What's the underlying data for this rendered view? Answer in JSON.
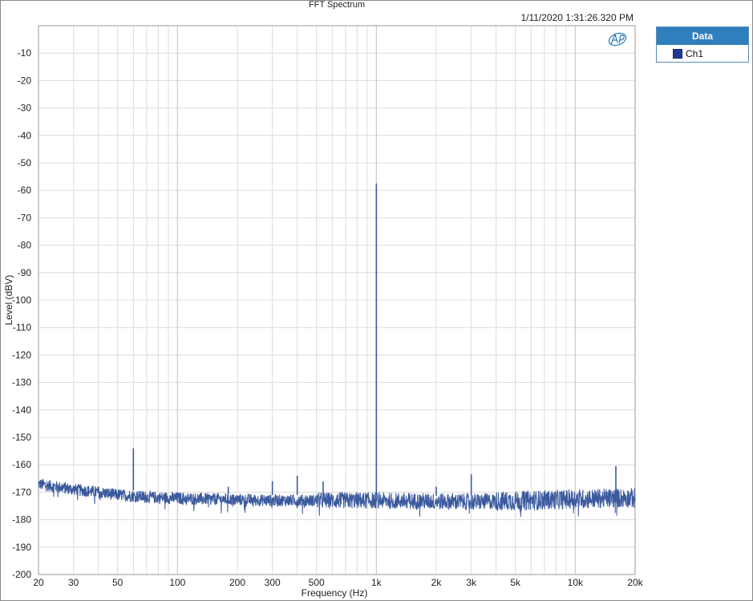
{
  "chart_data": {
    "type": "line",
    "title": "FFT Spectrum",
    "timestamp": "1/11/2020 1:31:26.320 PM",
    "xlabel": "Frequency (Hz)",
    "ylabel": "Level (dBV)",
    "xscale": "log",
    "xlim": [
      20,
      20000
    ],
    "ylim": [
      -200,
      0
    ],
    "grid": true,
    "x_ticks": [
      {
        "value": 20,
        "label": "20"
      },
      {
        "value": 30,
        "label": "30"
      },
      {
        "value": 50,
        "label": "50"
      },
      {
        "value": 100,
        "label": "100"
      },
      {
        "value": 200,
        "label": "200"
      },
      {
        "value": 300,
        "label": "300"
      },
      {
        "value": 500,
        "label": "500"
      },
      {
        "value": 1000,
        "label": "1k"
      },
      {
        "value": 2000,
        "label": "2k"
      },
      {
        "value": 3000,
        "label": "3k"
      },
      {
        "value": 5000,
        "label": "5k"
      },
      {
        "value": 10000,
        "label": "10k"
      },
      {
        "value": 20000,
        "label": "20k"
      }
    ],
    "y_ticks": [
      {
        "value": -10,
        "label": "-10"
      },
      {
        "value": -20,
        "label": "-20"
      },
      {
        "value": -30,
        "label": "-30"
      },
      {
        "value": -40,
        "label": "-40"
      },
      {
        "value": -50,
        "label": "-50"
      },
      {
        "value": -60,
        "label": "-60"
      },
      {
        "value": -70,
        "label": "-70"
      },
      {
        "value": -80,
        "label": "-80"
      },
      {
        "value": -90,
        "label": "-90"
      },
      {
        "value": -100,
        "label": "-100"
      },
      {
        "value": -110,
        "label": "-110"
      },
      {
        "value": -120,
        "label": "-120"
      },
      {
        "value": -130,
        "label": "-130"
      },
      {
        "value": -140,
        "label": "-140"
      },
      {
        "value": -150,
        "label": "-150"
      },
      {
        "value": -160,
        "label": "-160"
      },
      {
        "value": -170,
        "label": "-170"
      },
      {
        "value": -180,
        "label": "-180"
      },
      {
        "value": -190,
        "label": "-190"
      },
      {
        "value": -200,
        "label": "-200"
      }
    ],
    "legend": {
      "title": "Data",
      "placement": "right",
      "entries": [
        {
          "name": "Ch1",
          "color": "#1f3a93"
        }
      ]
    },
    "series": [
      {
        "name": "Ch1",
        "color": "#3b5a9e",
        "noise_floor_points": [
          [
            20,
            -167
          ],
          [
            30,
            -169
          ],
          [
            40,
            -170
          ],
          [
            50,
            -171
          ],
          [
            80,
            -172
          ],
          [
            150,
            -172.5
          ],
          [
            300,
            -173
          ],
          [
            1000,
            -173
          ],
          [
            3000,
            -173.5
          ],
          [
            6000,
            -173
          ],
          [
            10000,
            -172.5
          ],
          [
            20000,
            -172
          ]
        ],
        "peaks": [
          {
            "x": 60,
            "y": -154
          },
          {
            "x": 180,
            "y": -168
          },
          {
            "x": 300,
            "y": -166
          },
          {
            "x": 400,
            "y": -164
          },
          {
            "x": 540,
            "y": -166
          },
          {
            "x": 1000,
            "y": -57.5
          },
          {
            "x": 2000,
            "y": -168
          },
          {
            "x": 3000,
            "y": -163.5
          },
          {
            "x": 16000,
            "y": -160.5
          }
        ]
      }
    ]
  }
}
